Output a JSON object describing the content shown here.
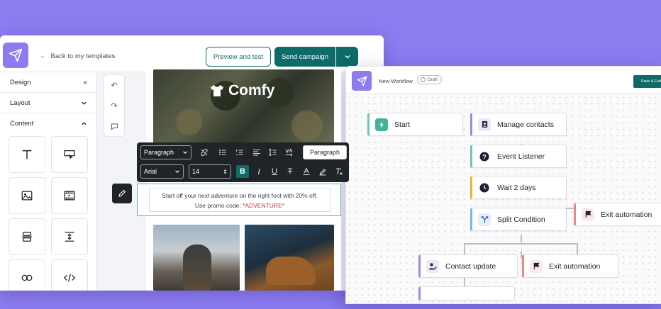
{
  "editor": {
    "back_label": "Back to my templates",
    "preview_label": "Preview and test",
    "send_label": "Send campaign",
    "sidebar": {
      "design_label": "Design",
      "layout_label": "Layout",
      "content_label": "Content",
      "tiles": [
        "text-block-icon",
        "button-block-icon",
        "image-block-icon",
        "video-block-icon",
        "divider-block-icon",
        "spacer-block-icon",
        "social-block-icon",
        "html-block-icon"
      ]
    },
    "email": {
      "brand": "Comfy",
      "body_line1": "Start off your next adventure on the right foot with 20% off.",
      "body_line2_prefix": "Use promo code: ",
      "promo_code": "*ADVENTURE*"
    },
    "toolbar": {
      "block_type": "Paragraph",
      "font": "Arial",
      "size": "14",
      "paragraph_button": "Paragraph"
    }
  },
  "workflow": {
    "title": "New Workflow",
    "status": "Draft",
    "save_label": "Save & Exit",
    "nodes": {
      "start": "Start",
      "manage_contacts": "Manage contacts",
      "event_listener": "Event Listener",
      "wait": "Wait 2 days",
      "split": "Split Condition",
      "exit_right": "Exit automation",
      "contact_update": "Contact update",
      "exit_bottom": "Exit automation"
    }
  },
  "colors": {
    "background": "#8b7cf0",
    "brand_teal": "#0e6b67",
    "promo_red": "#d0373d"
  }
}
